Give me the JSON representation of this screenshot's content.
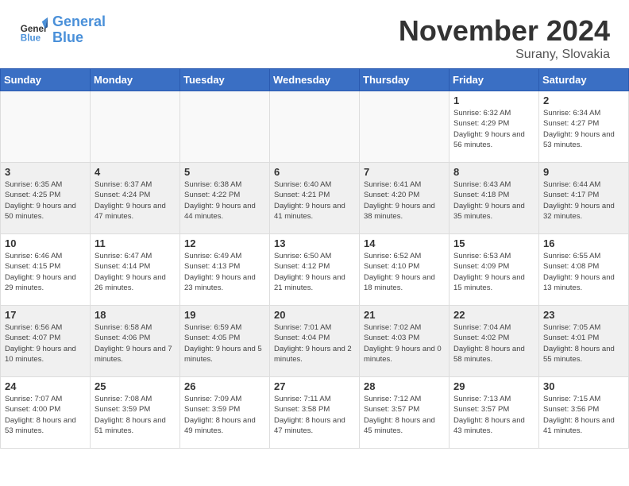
{
  "header": {
    "logo_line1": "General",
    "logo_line2": "Blue",
    "month_title": "November 2024",
    "location": "Surany, Slovakia"
  },
  "days_of_week": [
    "Sunday",
    "Monday",
    "Tuesday",
    "Wednesday",
    "Thursday",
    "Friday",
    "Saturday"
  ],
  "weeks": [
    [
      {
        "day": "",
        "empty": true
      },
      {
        "day": "",
        "empty": true
      },
      {
        "day": "",
        "empty": true
      },
      {
        "day": "",
        "empty": true
      },
      {
        "day": "",
        "empty": true
      },
      {
        "day": "1",
        "info": "Sunrise: 6:32 AM\nSunset: 4:29 PM\nDaylight: 9 hours and 56 minutes."
      },
      {
        "day": "2",
        "info": "Sunrise: 6:34 AM\nSunset: 4:27 PM\nDaylight: 9 hours and 53 minutes."
      }
    ],
    [
      {
        "day": "3",
        "info": "Sunrise: 6:35 AM\nSunset: 4:25 PM\nDaylight: 9 hours and 50 minutes."
      },
      {
        "day": "4",
        "info": "Sunrise: 6:37 AM\nSunset: 4:24 PM\nDaylight: 9 hours and 47 minutes."
      },
      {
        "day": "5",
        "info": "Sunrise: 6:38 AM\nSunset: 4:22 PM\nDaylight: 9 hours and 44 minutes."
      },
      {
        "day": "6",
        "info": "Sunrise: 6:40 AM\nSunset: 4:21 PM\nDaylight: 9 hours and 41 minutes."
      },
      {
        "day": "7",
        "info": "Sunrise: 6:41 AM\nSunset: 4:20 PM\nDaylight: 9 hours and 38 minutes."
      },
      {
        "day": "8",
        "info": "Sunrise: 6:43 AM\nSunset: 4:18 PM\nDaylight: 9 hours and 35 minutes."
      },
      {
        "day": "9",
        "info": "Sunrise: 6:44 AM\nSunset: 4:17 PM\nDaylight: 9 hours and 32 minutes."
      }
    ],
    [
      {
        "day": "10",
        "info": "Sunrise: 6:46 AM\nSunset: 4:15 PM\nDaylight: 9 hours and 29 minutes."
      },
      {
        "day": "11",
        "info": "Sunrise: 6:47 AM\nSunset: 4:14 PM\nDaylight: 9 hours and 26 minutes."
      },
      {
        "day": "12",
        "info": "Sunrise: 6:49 AM\nSunset: 4:13 PM\nDaylight: 9 hours and 23 minutes."
      },
      {
        "day": "13",
        "info": "Sunrise: 6:50 AM\nSunset: 4:12 PM\nDaylight: 9 hours and 21 minutes."
      },
      {
        "day": "14",
        "info": "Sunrise: 6:52 AM\nSunset: 4:10 PM\nDaylight: 9 hours and 18 minutes."
      },
      {
        "day": "15",
        "info": "Sunrise: 6:53 AM\nSunset: 4:09 PM\nDaylight: 9 hours and 15 minutes."
      },
      {
        "day": "16",
        "info": "Sunrise: 6:55 AM\nSunset: 4:08 PM\nDaylight: 9 hours and 13 minutes."
      }
    ],
    [
      {
        "day": "17",
        "info": "Sunrise: 6:56 AM\nSunset: 4:07 PM\nDaylight: 9 hours and 10 minutes."
      },
      {
        "day": "18",
        "info": "Sunrise: 6:58 AM\nSunset: 4:06 PM\nDaylight: 9 hours and 7 minutes."
      },
      {
        "day": "19",
        "info": "Sunrise: 6:59 AM\nSunset: 4:05 PM\nDaylight: 9 hours and 5 minutes."
      },
      {
        "day": "20",
        "info": "Sunrise: 7:01 AM\nSunset: 4:04 PM\nDaylight: 9 hours and 2 minutes."
      },
      {
        "day": "21",
        "info": "Sunrise: 7:02 AM\nSunset: 4:03 PM\nDaylight: 9 hours and 0 minutes."
      },
      {
        "day": "22",
        "info": "Sunrise: 7:04 AM\nSunset: 4:02 PM\nDaylight: 8 hours and 58 minutes."
      },
      {
        "day": "23",
        "info": "Sunrise: 7:05 AM\nSunset: 4:01 PM\nDaylight: 8 hours and 55 minutes."
      }
    ],
    [
      {
        "day": "24",
        "info": "Sunrise: 7:07 AM\nSunset: 4:00 PM\nDaylight: 8 hours and 53 minutes."
      },
      {
        "day": "25",
        "info": "Sunrise: 7:08 AM\nSunset: 3:59 PM\nDaylight: 8 hours and 51 minutes."
      },
      {
        "day": "26",
        "info": "Sunrise: 7:09 AM\nSunset: 3:59 PM\nDaylight: 8 hours and 49 minutes."
      },
      {
        "day": "27",
        "info": "Sunrise: 7:11 AM\nSunset: 3:58 PM\nDaylight: 8 hours and 47 minutes."
      },
      {
        "day": "28",
        "info": "Sunrise: 7:12 AM\nSunset: 3:57 PM\nDaylight: 8 hours and 45 minutes."
      },
      {
        "day": "29",
        "info": "Sunrise: 7:13 AM\nSunset: 3:57 PM\nDaylight: 8 hours and 43 minutes."
      },
      {
        "day": "30",
        "info": "Sunrise: 7:15 AM\nSunset: 3:56 PM\nDaylight: 8 hours and 41 minutes."
      }
    ]
  ]
}
